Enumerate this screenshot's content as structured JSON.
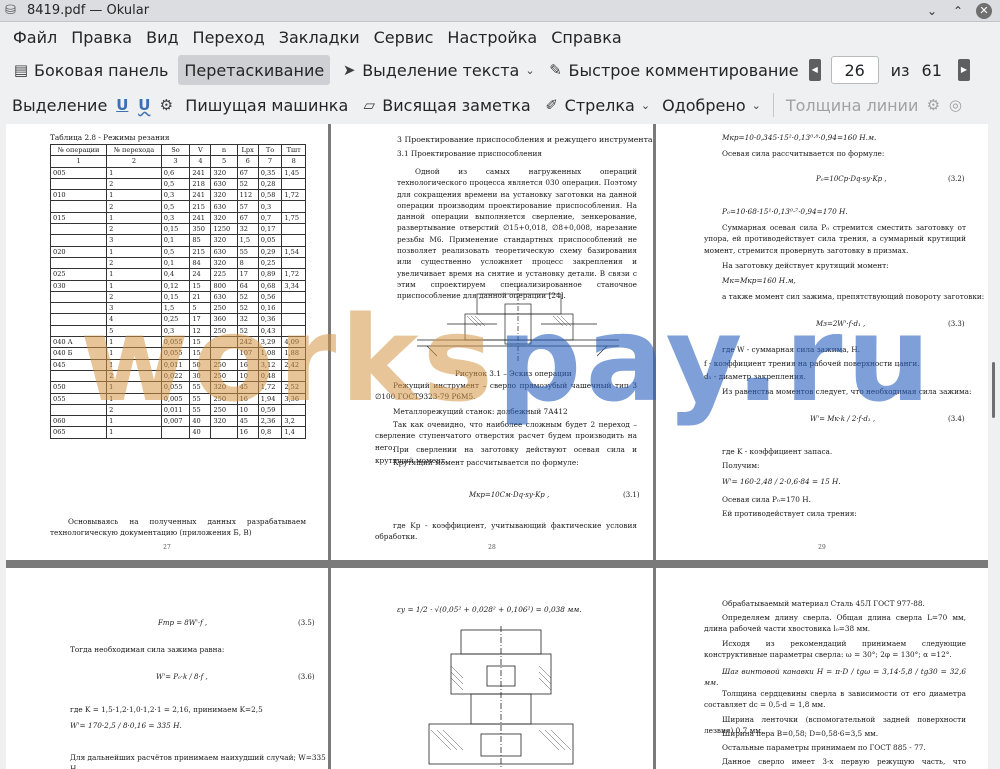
{
  "window": {
    "title": "8419.pdf — Okular"
  },
  "menu": [
    "Файл",
    "Правка",
    "Вид",
    "Переход",
    "Закладки",
    "Сервис",
    "Настройка",
    "Справка"
  ],
  "toolbar1": {
    "sidebar": "Боковая панель",
    "drag": "Перетаскивание",
    "text_select": "Выделение текста",
    "quick_comment": "Быстрое комментирование",
    "page_current": "26",
    "page_of": "из",
    "page_total": "61"
  },
  "toolbar2": {
    "selection": "Выделение",
    "typewriter": "Пишущая машинка",
    "note": "Висящая заметка",
    "arrow": "Стрелка",
    "approved": "Одобрено",
    "line_width": "Толщина линии"
  },
  "pages": {
    "p27": {
      "caption": "Таблица 2.8 - Режимы резания",
      "headers": [
        "№ операции",
        "№ перехода",
        "Sо",
        "V",
        "n",
        "Lрх",
        "Tо",
        "Tшт"
      ],
      "header_nums": [
        "1",
        "2",
        "3",
        "4",
        "5",
        "6",
        "7",
        "8"
      ],
      "rows": [
        [
          "005",
          "1",
          "0,6",
          "241",
          "320",
          "67",
          "0,35",
          "1,45"
        ],
        [
          "",
          "2",
          "0,5",
          "218",
          "630",
          "52",
          "0,28",
          ""
        ],
        [
          "010",
          "1",
          "0,3",
          "241",
          "320",
          "112",
          "0,58",
          "1,72"
        ],
        [
          "",
          "2",
          "0,5",
          "215",
          "630",
          "57",
          "0,3",
          ""
        ],
        [
          "015",
          "1",
          "0,3",
          "241",
          "320",
          "67",
          "0,7",
          "1,75"
        ],
        [
          "",
          "2",
          "0,15",
          "350",
          "1250",
          "32",
          "0,17",
          ""
        ],
        [
          "",
          "3",
          "0,1",
          "85",
          "320",
          "1,5",
          "0,05",
          ""
        ],
        [
          "020",
          "1",
          "0,5",
          "215",
          "630",
          "55",
          "0,29",
          "1,54"
        ],
        [
          "",
          "2",
          "0,1",
          "84",
          "320",
          "8",
          "0,25",
          ""
        ],
        [
          "025",
          "1",
          "0,4",
          "24",
          "225",
          "17",
          "0,89",
          "1,72"
        ],
        [
          "030",
          "1",
          "0,12",
          "15",
          "800",
          "64",
          "0,68",
          "3,34"
        ],
        [
          "",
          "2",
          "0,15",
          "21",
          "630",
          "52",
          "0,56",
          ""
        ],
        [
          "",
          "3",
          "1,5",
          "5",
          "250",
          "52",
          "0,16",
          ""
        ],
        [
          "",
          "4",
          "0,25",
          "17",
          "360",
          "32",
          "0,36",
          ""
        ],
        [
          "",
          "5",
          "0,3",
          "12",
          "250",
          "52",
          "0,43",
          ""
        ],
        [
          "040 А",
          "1",
          "0,055",
          "15",
          "",
          "242",
          "3,29",
          "4,09"
        ],
        [
          "040 Б",
          "1",
          "0,055",
          "15",
          "",
          "107",
          "1,08",
          "1,88"
        ],
        [
          "045",
          "1",
          "0,011",
          "50",
          "250",
          "16",
          "3,12",
          "2,42"
        ],
        [
          "",
          "2",
          "0,022",
          "30",
          "250",
          "10",
          "0,48",
          ""
        ],
        [
          "050",
          "1",
          "0,055",
          "55",
          "320",
          "45",
          "1,72",
          "2,52"
        ],
        [
          "055",
          "1",
          "0,005",
          "55",
          "250",
          "16",
          "1,94",
          "3,36"
        ],
        [
          "",
          "2",
          "0,011",
          "55",
          "250",
          "10",
          "0,59",
          ""
        ],
        [
          "060",
          "1",
          "0,007",
          "40",
          "320",
          "45",
          "2,36",
          "3,2"
        ],
        [
          "065",
          "1",
          "",
          "40",
          "",
          "16",
          "0,8",
          "1,4"
        ]
      ],
      "after": "Основываясь на полученных данных разрабатываем технологическую документацию (приложения Б, В)",
      "num": "27"
    },
    "p28": {
      "h1": "3 Проектирование приспособления и режущего инструмента",
      "h2": "3.1 Проектирование приспособления",
      "para1": "Одной из самых нагруженных операций технологического процесса является 030 операция. Поэтому для сокращения времени на установку заготовки на данной операции производим проектирование приспособления. На данной операции выполняется сверление, зенкерование, развертывание отверстий ∅15+0,018, ∅8+0,008, нарезание резьбы М6. Применение стандартных приспособлений не позволяет реализовать теоретическую схему базирования или существенно усложняет процесс закрепления и увеличивает время на снятие и установку детали. В связи с этим спроектируем специализированное станочное приспособление для данной операции [24].",
      "fig": "Рисунок 3.1 – Эскиз операции",
      "para2": "Режущий инструмент – сверло прямозубый чашечный тип 3 ∅100 ГОСТ9323-79 Р6М5.",
      "para3": "Металлорежущий станок: долбежный 7А412",
      "para4": "Так как очевидно, что наиболее сложным будет 2 переход – сверление ступенчатого отверстия расчет будем производить на него.",
      "para5": "При сверлении на заготовку действуют осевая сила и крутящий момент.",
      "para6": "Крутящий момент рассчитывается по формуле:",
      "formula": "Mкр=10Cм·Dq·sy·Kр ,",
      "fnum": "(3.1)",
      "para7": "где Kр - коэффициент, учитывающий фактические условия обработки.",
      "num": "28"
    },
    "p29": {
      "l1": "Mкр=10·0,345·15²·0,13⁰·⁸·0,94=160 Н.м.",
      "l2": "Осевая сила рассчитывается по формуле:",
      "f1": "P₀=10Cр·Dq·sy·Kр ,",
      "f1n": "(3.2)",
      "l3": "P₀=10·68·15¹·0,13⁰·⁷·0,94=170 Н.",
      "l4": "Суммарная осевая сила P₀ стремится сместить заготовку от упора, ей противодействует сила трения, а суммарный крутящий момент, стремится провернуть заготовку в призмах.",
      "l5": "На заготовку действует крутящий момент:",
      "l6": "Mк=Mкр=160 Н.м,",
      "l7": "а также момент сил зажима, препятствующий повороту заготовки:",
      "f2": "Mз=2W'·f·d₁ ,",
      "f2n": "(3.3)",
      "l8": "где W - суммарная сила зажима, Н.",
      "l9": "f - коэффициент трения на рабочей поверхности цанги.",
      "l10": "d₁ - диаметр закрепления.",
      "l11": "Из равенства моментов следует, что необходимая сила зажима:",
      "f3": "W'= Mк·k / 2·f·d₁ ,",
      "f3n": "(3.4)",
      "l12": "где K - коэффициент запаса.",
      "l13": "Получим:",
      "l14": "W'= 160·2,48 / 2·0,6·84 = 15 Н.",
      "l15": "Осевая сила P₀=170 Н.",
      "l16": "Ей противодействует сила трения:",
      "num": "29"
    },
    "p30": {
      "f1": "Fтр = 8W'·f ,",
      "f1n": "(3.5)",
      "l1": "Тогда необходимая сила зажима равна:",
      "f2": "W'= P₀·k / 8·f ,",
      "f2n": "(3.6)",
      "l2": "где K = 1,5·1,2·1,0·1,2·1 = 2,16, принимаем K=2,5",
      "l3": "W'= 170·2,5 / 8·0,16 = 335 Н.",
      "l4": "Для дальнейших расчётов принимаем наихудший случай; W=335 Н"
    },
    "p31": {
      "l1": "εу = 1/2 · √(0,05² + 0,028² + 0,106²) = 0,038 мм."
    },
    "p32": {
      "l1": "Обрабатываемый материал Сталь 45Л ГОСТ 977-88.",
      "l2": "Определяем длину сверла. Общая длина сверла L=70 мм, длина рабочей части хвостовика l₀=38 мм.",
      "l3": "Исходя из рекомендаций принимаем следующие конструктивные параметры сверла: ω = 30°; 2φ = 130°; α =12°.",
      "l4": "Шаг винтовой канавки H = π·D / tgω = 3,14·5,8 / tg30 = 32,6 мм.",
      "l5": "Толщина сердцевины сверла в зависимости от его диаметра составляет dс = 0,5·d = 1,8 мм.",
      "l6": "Ширина ленточки (вспомогательной задней поверхности лезвия) 0,7 мм.",
      "l7": "Ширина пера В=0,58; D=0,58·6=3,5 мм.",
      "l8": "Остальные параметры принимаем по ГОСТ 885 - 77.",
      "l9": "Данное сверло имеет 3-х первую режущую часть, что обеспечивает"
    }
  },
  "watermark": {
    "part1": "works",
    "part2": "pay.ru"
  }
}
